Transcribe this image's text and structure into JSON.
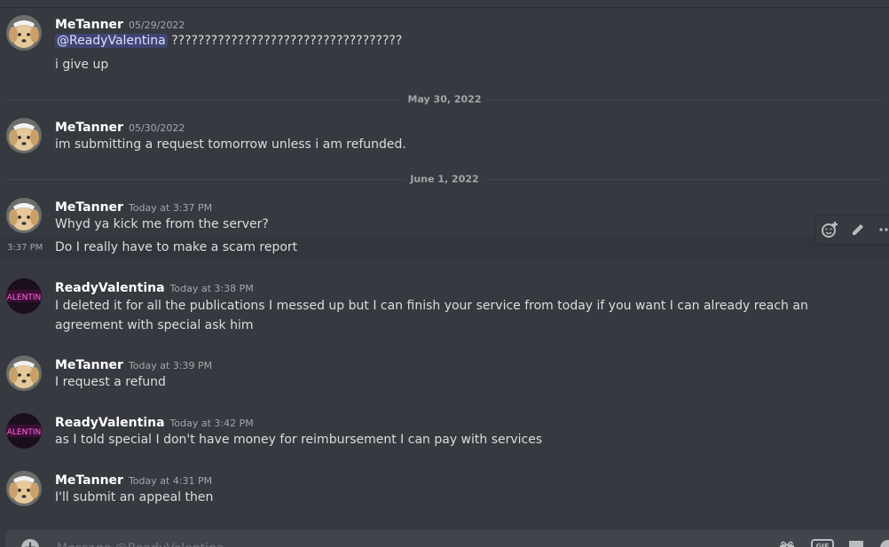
{
  "divider_dates": [
    "May 30, 2022",
    "June 1, 2022"
  ],
  "messages": [
    {
      "username": "MeTanner",
      "timestamp": "05/29/2022",
      "mention": "@ReadyValentina",
      "lines": [
        "???????????????????????????????????",
        "i give up"
      ]
    },
    {
      "username": "MeTanner",
      "timestamp": "05/30/2022",
      "lines": [
        "im submitting a request tomorrow unless i am refunded."
      ]
    },
    {
      "username": "MeTanner",
      "timestamp": "Today at 3:37 PM",
      "lines": [
        "Whyd ya kick me from the server?",
        "Do I really have to make a scam report"
      ],
      "hover_time": "3:37 PM"
    },
    {
      "username": "ReadyValentina",
      "timestamp": "Today at 3:38 PM",
      "lines": [
        "I deleted it for all the publications I messed up but I can finish your service from today if you want I can already reach an agreement with special ask him"
      ]
    },
    {
      "username": "MeTanner",
      "timestamp": "Today at 3:39 PM",
      "lines": [
        "I request a refund"
      ]
    },
    {
      "username": "ReadyValentina",
      "timestamp": "Today at 3:42 PM",
      "lines": [
        "as I told special I don't have money for reimbursement I can pay with services"
      ]
    },
    {
      "username": "MeTanner",
      "timestamp": "Today at 4:31 PM",
      "lines": [
        "I'll submit an appeal then"
      ]
    }
  ],
  "toolbar": {
    "icons": [
      "add-reaction-icon",
      "edit-icon",
      "more-icon"
    ]
  },
  "composer": {
    "placeholder": "Message @ReadyValentina",
    "icons": [
      "add-attachment-icon",
      "gift-icon",
      "gif-icon",
      "sticker-icon",
      "emoji-icon"
    ],
    "gif_label": "GIF"
  },
  "colors": {
    "background": "#36393f",
    "mention_bg": "#414675",
    "username": "#ffffff",
    "timestamp": "#a3a6aa"
  }
}
